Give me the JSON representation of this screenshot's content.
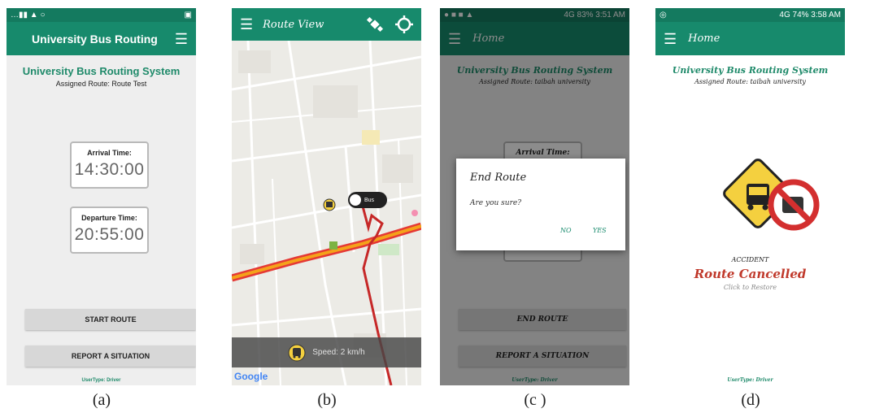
{
  "captions": [
    "(a)",
    "(b)",
    "(c )",
    "(d)"
  ],
  "colors": {
    "primary": "#178a6c",
    "primary_dark": "#147a5f",
    "route_red": "#c62828",
    "road_orange": "#f4a21a",
    "cancel_red": "#c0392b"
  },
  "screen_a": {
    "status_bar": {
      "left": "…▮▮ ▲ ○",
      "right": "▣"
    },
    "app_title": "University Bus Routing",
    "menu_icon": "hamburger-icon",
    "system_title": "University Bus Routing System",
    "assigned_route": "Assigned Route: Route Test",
    "arrival_label": "Arrival Time:",
    "arrival_value": "14:30:00",
    "departure_label": "Departure Time:",
    "departure_value": "20:55:00",
    "start_button": "START ROUTE",
    "report_button": "REPORT A SITUATION",
    "user_type": "UserType: Driver"
  },
  "screen_b": {
    "app_title": "Route View",
    "menu_icon": "hamburger-icon",
    "action_icons": [
      "satellite-icon",
      "locate-icon"
    ],
    "bus_label": "Bus",
    "speed_text": "Speed: 2 km/h",
    "map_brand": "Google"
  },
  "screen_c": {
    "status_right": "4G 83% 3:51 AM",
    "app_title": "Home",
    "system_title": "University Bus Routing System",
    "assigned_route": "Assigned Route: taibah university",
    "arrival_label": "Arrival Time:",
    "dialog_title": "End Route",
    "dialog_message": "Are you sure?",
    "dialog_no": "NO",
    "dialog_yes": "YES",
    "end_button": "END ROUTE",
    "report_button": "REPORT A SITUATION",
    "user_type": "UserType: Driver"
  },
  "screen_d": {
    "status_right": "4G 74% 3:58 AM",
    "app_title": "Home",
    "system_title": "University Bus Routing System",
    "assigned_route": "Assigned Route: taibah university",
    "warning_icon": "bus-cancelled-icon",
    "accident_label": "ACCIDENT",
    "cancelled_label": "Route Cancelled",
    "restore_label": "Click to Restore",
    "user_type": "UserType: Driver"
  }
}
